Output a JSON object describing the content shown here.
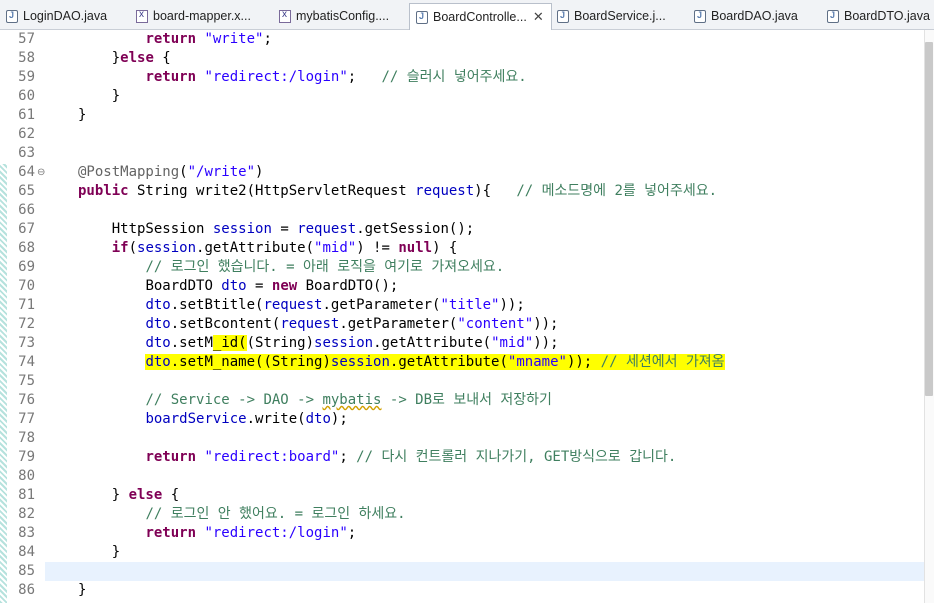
{
  "tabs": [
    {
      "label": "LoginDAO.java",
      "icon": "java-file-icon",
      "active": false
    },
    {
      "label": "board-mapper.x...",
      "icon": "xml-file-icon",
      "active": false
    },
    {
      "label": "mybatisConfig....",
      "icon": "xml-file-icon",
      "active": false
    },
    {
      "label": "BoardControlle...",
      "icon": "java-file-icon",
      "active": true,
      "close": "✕"
    },
    {
      "label": "BoardService.j...",
      "icon": "java-file-icon",
      "active": false
    },
    {
      "label": "BoardDAO.java",
      "icon": "java-file-icon",
      "active": false
    },
    {
      "label": "BoardDTO.java",
      "icon": "java-file-icon",
      "active": false
    }
  ],
  "editor": {
    "current_line": 85,
    "lines": [
      {
        "n": "57",
        "indent": "        ",
        "tokens": [
          {
            "t": "return",
            "c": "kw"
          },
          {
            "t": " "
          },
          {
            "t": "\"write\"",
            "c": "str"
          },
          {
            "t": ";"
          }
        ]
      },
      {
        "n": "58",
        "indent": "    ",
        "tokens": [
          {
            "t": "}"
          },
          {
            "t": "else",
            "c": "kw"
          },
          {
            "t": " {"
          }
        ]
      },
      {
        "n": "59",
        "indent": "        ",
        "tokens": [
          {
            "t": "return",
            "c": "kw"
          },
          {
            "t": " "
          },
          {
            "t": "\"redirect:/login\"",
            "c": "str"
          },
          {
            "t": ";   "
          },
          {
            "t": "// 슬러시 넣어주세요.",
            "c": "cm"
          }
        ]
      },
      {
        "n": "60",
        "indent": "    ",
        "tokens": [
          {
            "t": "}"
          }
        ]
      },
      {
        "n": "61",
        "indent": "",
        "tokens": [
          {
            "t": "}"
          }
        ]
      },
      {
        "n": "62",
        "indent": "",
        "tokens": []
      },
      {
        "n": "63",
        "indent": "",
        "tokens": []
      },
      {
        "n": "64",
        "fold": "⊖",
        "indent": "",
        "tokens": [
          {
            "t": "@PostMapping",
            "c": "ann"
          },
          {
            "t": "("
          },
          {
            "t": "\"/write\"",
            "c": "str"
          },
          {
            "t": ")"
          }
        ]
      },
      {
        "n": "65",
        "indent": "",
        "tokens": [
          {
            "t": "public",
            "c": "kw"
          },
          {
            "t": " String write2(HttpServletRequest "
          },
          {
            "t": "request",
            "c": "fld"
          },
          {
            "t": "){   "
          },
          {
            "t": "// 메소드명에 2를 넣어주세요.",
            "c": "cm"
          }
        ]
      },
      {
        "n": "66",
        "indent": "",
        "tokens": []
      },
      {
        "n": "67",
        "indent": "    ",
        "tokens": [
          {
            "t": "HttpSession "
          },
          {
            "t": "session",
            "c": "fld"
          },
          {
            "t": " = "
          },
          {
            "t": "request",
            "c": "fld"
          },
          {
            "t": ".getSession();"
          }
        ]
      },
      {
        "n": "68",
        "indent": "    ",
        "tokens": [
          {
            "t": "if",
            "c": "kw"
          },
          {
            "t": "("
          },
          {
            "t": "session",
            "c": "fld"
          },
          {
            "t": ".getAttribute("
          },
          {
            "t": "\"mid\"",
            "c": "str"
          },
          {
            "t": ") != "
          },
          {
            "t": "null",
            "c": "kw"
          },
          {
            "t": ") {"
          }
        ]
      },
      {
        "n": "69",
        "indent": "        ",
        "tokens": [
          {
            "t": "// 로그인 했습니다. = 아래 로직을 여기로 가져오세요.",
            "c": "cm"
          }
        ]
      },
      {
        "n": "70",
        "indent": "        ",
        "tokens": [
          {
            "t": "BoardDTO "
          },
          {
            "t": "dto",
            "c": "fld"
          },
          {
            "t": " = "
          },
          {
            "t": "new",
            "c": "kw"
          },
          {
            "t": " BoardDTO();"
          }
        ]
      },
      {
        "n": "71",
        "indent": "        ",
        "tokens": [
          {
            "t": "dto",
            "c": "fld"
          },
          {
            "t": ".setBtitle("
          },
          {
            "t": "request",
            "c": "fld"
          },
          {
            "t": ".getParameter("
          },
          {
            "t": "\"title\"",
            "c": "str"
          },
          {
            "t": "));"
          }
        ]
      },
      {
        "n": "72",
        "indent": "        ",
        "tokens": [
          {
            "t": "dto",
            "c": "fld"
          },
          {
            "t": ".setBcontent("
          },
          {
            "t": "request",
            "c": "fld"
          },
          {
            "t": ".getParameter("
          },
          {
            "t": "\"content\"",
            "c": "str"
          },
          {
            "t": "));"
          }
        ]
      },
      {
        "n": "73",
        "indent": "        ",
        "tokens": [
          {
            "t": "dto",
            "c": "fld"
          },
          {
            "t": ".setM"
          },
          {
            "t": "_id(",
            "hl": true
          },
          {
            "t": "(String)"
          },
          {
            "t": "session",
            "c": "fld"
          },
          {
            "t": ".getAttribute("
          },
          {
            "t": "\"mid\"",
            "c": "str"
          },
          {
            "t": "));"
          }
        ]
      },
      {
        "n": "74",
        "indent": "        ",
        "tokens": [
          {
            "t": "dto",
            "c": "fld",
            "hl": true
          },
          {
            "t": ".setM_name((String)",
            "hl": true
          },
          {
            "t": "session",
            "c": "fld",
            "hl": true
          },
          {
            "t": ".getAttribute(",
            "hl": true
          },
          {
            "t": "\"mname\"",
            "c": "str",
            "hl": true
          },
          {
            "t": ")); ",
            "hl": true
          },
          {
            "t": "// 세션에서 가져옴",
            "c": "cm",
            "hl": true
          }
        ]
      },
      {
        "n": "75",
        "indent": "",
        "tokens": []
      },
      {
        "n": "76",
        "indent": "        ",
        "tokens": [
          {
            "t": "// Service -> DAO -> ",
            "c": "cm"
          },
          {
            "t": "mybatis",
            "c": "cm",
            "sq": true
          },
          {
            "t": " -> DB로 보내서 저장하기",
            "c": "cm"
          }
        ]
      },
      {
        "n": "77",
        "indent": "        ",
        "tokens": [
          {
            "t": "boardService",
            "c": "fld"
          },
          {
            "t": ".write("
          },
          {
            "t": "dto",
            "c": "fld"
          },
          {
            "t": ");"
          }
        ]
      },
      {
        "n": "78",
        "indent": "",
        "tokens": []
      },
      {
        "n": "79",
        "indent": "        ",
        "tokens": [
          {
            "t": "return",
            "c": "kw"
          },
          {
            "t": " "
          },
          {
            "t": "\"redirect:board\"",
            "c": "str"
          },
          {
            "t": "; "
          },
          {
            "t": "// 다시 컨트롤러 지나가기, GET방식으로 갑니다.",
            "c": "cm"
          }
        ]
      },
      {
        "n": "80",
        "indent": "",
        "tokens": []
      },
      {
        "n": "81",
        "indent": "    ",
        "tokens": [
          {
            "t": "} "
          },
          {
            "t": "else",
            "c": "kw"
          },
          {
            "t": " {"
          }
        ]
      },
      {
        "n": "82",
        "indent": "        ",
        "tokens": [
          {
            "t": "// 로그인 안 했어요. = 로그인 하세요.",
            "c": "cm"
          }
        ]
      },
      {
        "n": "83",
        "indent": "        ",
        "tokens": [
          {
            "t": "return",
            "c": "kw"
          },
          {
            "t": " "
          },
          {
            "t": "\"redirect:/login\"",
            "c": "str"
          },
          {
            "t": ";"
          }
        ]
      },
      {
        "n": "84",
        "indent": "    ",
        "tokens": [
          {
            "t": "}"
          }
        ]
      },
      {
        "n": "85",
        "indent": "",
        "tokens": []
      },
      {
        "n": "86",
        "indent": "",
        "tokens": [
          {
            "t": "}"
          }
        ]
      }
    ]
  }
}
